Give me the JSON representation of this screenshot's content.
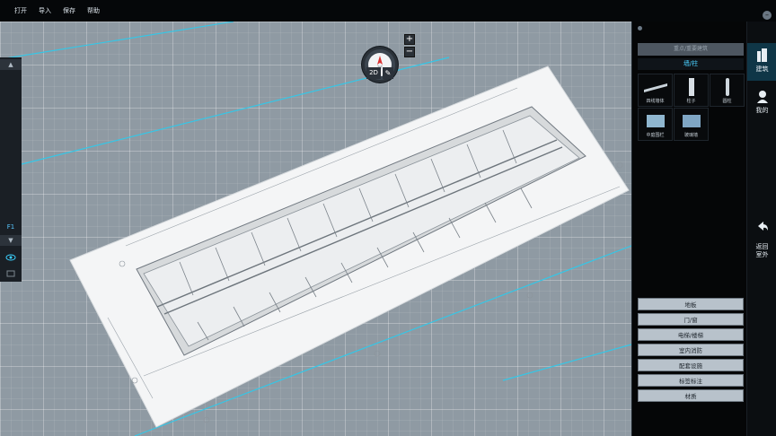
{
  "menu": [
    "打开",
    "导入",
    "保存",
    "帮助"
  ],
  "view": {
    "mode_label": "2D",
    "floor": "F1"
  },
  "panel": {
    "search_placeholder": "重点/重要建筑",
    "group_title": "墙/柱",
    "components": [
      {
        "label": "四线墙体",
        "icon": "wall-icon"
      },
      {
        "label": "柱子",
        "icon": "column-icon"
      },
      {
        "label": "圆柱",
        "icon": "round-column-icon"
      },
      {
        "label": "中庭围栏",
        "icon": "atrium-railing-icon"
      },
      {
        "label": "玻璃墙",
        "icon": "glass-wall-icon"
      }
    ],
    "categories": [
      "地板",
      "门/窗",
      "电梯/楼梯",
      "室内消防",
      "配套设施",
      "标签标注",
      "材质"
    ]
  },
  "sidenav": {
    "items": [
      {
        "label": "建筑",
        "icon": "building-icon",
        "active": true
      },
      {
        "label": "我的",
        "icon": "user-icon",
        "active": false
      },
      {
        "label": "返回\n室外",
        "icon": "back-arrow-icon",
        "active": false
      }
    ]
  },
  "colors": {
    "accent": "#4ad0ff",
    "panel_bg": "#050607",
    "grid_bg": "#8f9aa3"
  }
}
